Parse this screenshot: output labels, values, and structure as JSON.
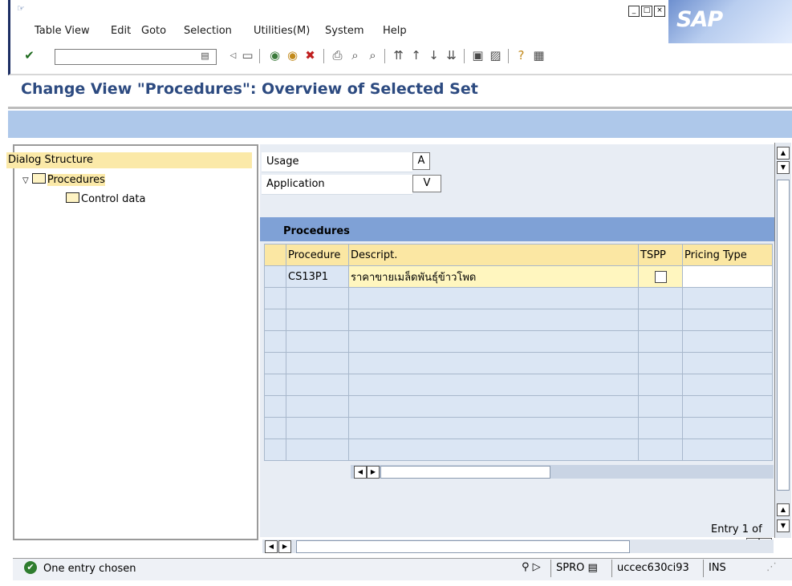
{
  "menu": {
    "items": [
      {
        "label": "Table View"
      },
      {
        "label": "Edit"
      },
      {
        "label": "Goto"
      },
      {
        "label": "Selection"
      },
      {
        "label": "Utilities(M)"
      },
      {
        "label": "System"
      },
      {
        "label": "Help"
      }
    ]
  },
  "window": {
    "minimize_icon": "minimize-icon",
    "maximize_icon": "maximize-icon",
    "close_icon": "close-icon",
    "logo_text": "SAP"
  },
  "toolbar": {
    "command_field_value": "",
    "icons": [
      "enter-icon",
      "save-icon",
      "back-icon",
      "exit-icon",
      "cancel-icon",
      "print-icon",
      "find-icon",
      "find-next-icon",
      "first-page-icon",
      "previous-page-icon",
      "next-page-icon",
      "last-page-icon",
      "create-session-icon",
      "shortcut-icon",
      "help-icon",
      "layout-icon"
    ]
  },
  "page": {
    "title": "Change View \"Procedures\": Overview of Selected Set"
  },
  "dialog_structure": {
    "header": "Dialog Structure",
    "items": [
      {
        "label": "Procedures",
        "level": 1,
        "expanded": true
      },
      {
        "label": "Control data",
        "level": 2
      }
    ]
  },
  "fields": {
    "usage_label": "Usage",
    "usage_value": "A",
    "application_label": "Application",
    "application_value": "V"
  },
  "table": {
    "title": "Procedures",
    "columns": [
      "Procedure",
      "Descript.",
      "TSPP",
      "Pricing Type"
    ],
    "rows": [
      {
        "procedure": "CS13P1",
        "description": "ราคาขายเมล็ดพันธุ์ข้าวโพด",
        "tspp": false,
        "pricing_type": ""
      }
    ],
    "entry_label": "Entry 1 of"
  },
  "status": {
    "message": "One entry chosen",
    "transaction": "SPRO",
    "server": "uccec630ci93",
    "mode": "INS"
  }
}
